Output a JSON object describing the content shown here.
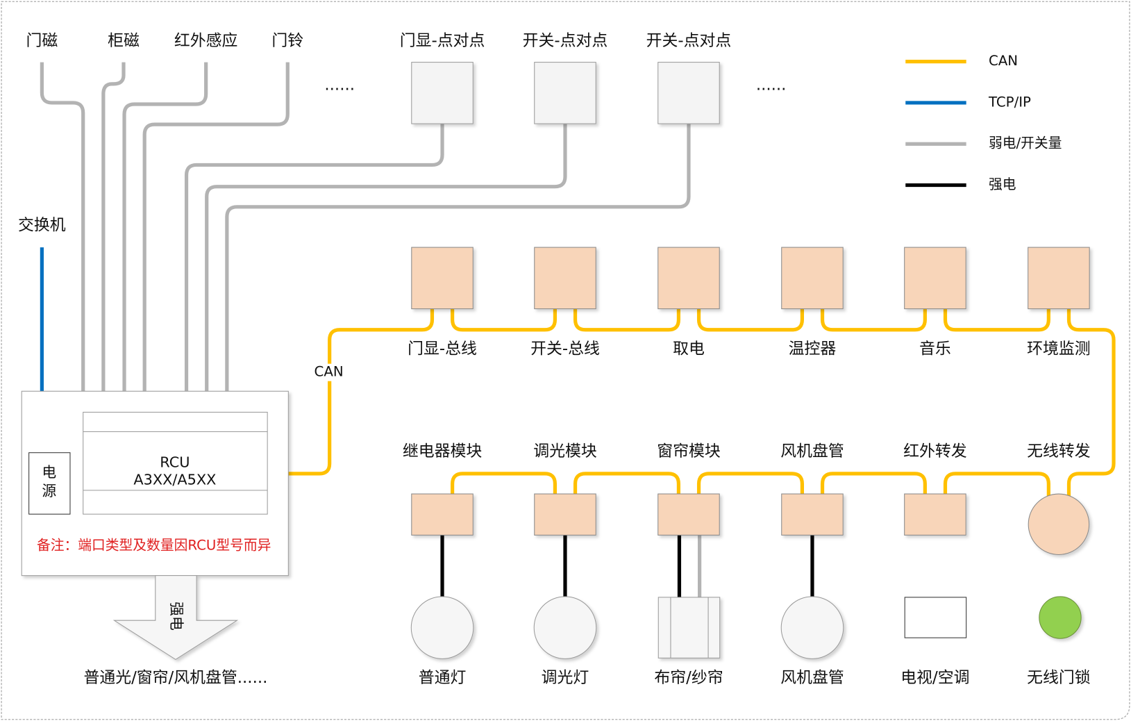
{
  "colors": {
    "can": "#FFC000",
    "tcpip": "#0070C0",
    "weak": "#B3B3B3",
    "strong": "#000000",
    "module_fill": "#F8D5B9",
    "note_red": "#E02020",
    "lock_green": "#92D050"
  },
  "top_inputs": [
    "门磁",
    "柜磁",
    "红外感应",
    "门铃"
  ],
  "ellipsis": "......",
  "point_devices": [
    "门显-点对点",
    "开关-点对点",
    "开关-点对点"
  ],
  "legend": [
    {
      "type": "can",
      "label": "CAN"
    },
    {
      "type": "tcpip",
      "label": "TCP/IP"
    },
    {
      "type": "weak",
      "label": "弱电/开关量"
    },
    {
      "type": "strong",
      "label": "强电"
    }
  ],
  "switch_label": "交换机",
  "can_label": "CAN",
  "bus_top_modules": [
    "门显-总线",
    "开关-总线",
    "取电",
    "温控器",
    "音乐",
    "环境监测"
  ],
  "bus_bottom_modules": [
    "继电器模块",
    "调光模块",
    "窗帘模块",
    "风机盘管",
    "红外转发",
    "无线转发"
  ],
  "end_devices": [
    "普通灯",
    "调光灯",
    "布帘/纱帘",
    "风机盘管",
    "电视/空调",
    "无线门锁"
  ],
  "rcu": {
    "name": "RCU",
    "model": "A3XX/A5XX",
    "power": [
      "电",
      "源"
    ],
    "note": "备注：端口类型及数量因RCU型号而异"
  },
  "strong_arrow": {
    "label": "强电",
    "target": "普通光/窗帘/风机盘管......"
  }
}
